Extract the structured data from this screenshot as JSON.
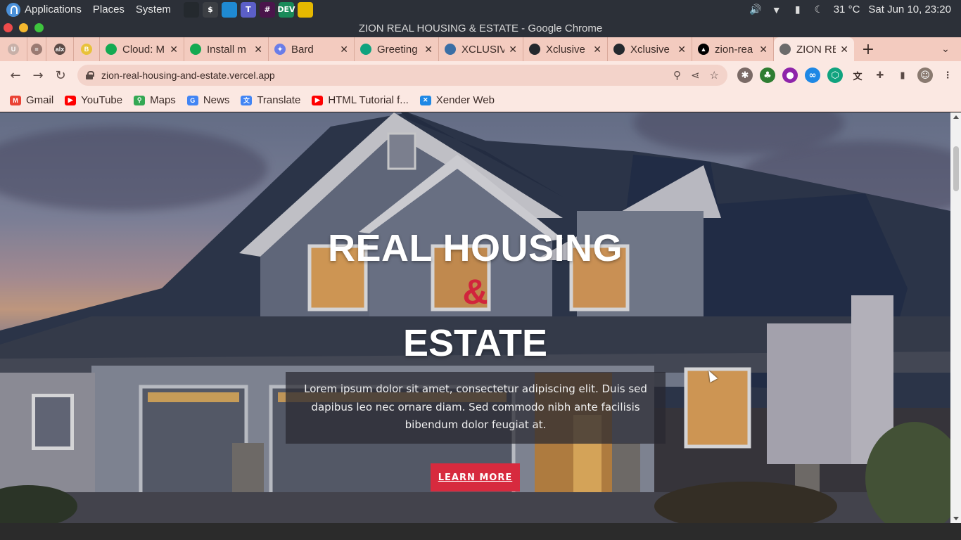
{
  "os_panel": {
    "menu": [
      "Applications",
      "Places",
      "System"
    ],
    "launchers": [
      {
        "name": "github-icon",
        "label": "",
        "color": "#24292e"
      },
      {
        "name": "terminal-icon",
        "label": "$",
        "color": "#3c3f44"
      },
      {
        "name": "vscode-icon",
        "label": "",
        "color": "#1f8ad2"
      },
      {
        "name": "teams-icon",
        "label": "T",
        "color": "#5b5fc7"
      },
      {
        "name": "slack-icon",
        "label": "#",
        "color": "#4a154b"
      },
      {
        "name": "edge-dev-icon",
        "label": "DEV",
        "color": "#1a8a5a"
      },
      {
        "name": "chrome-icon",
        "label": "",
        "color": "#e6b800"
      }
    ],
    "tray": {
      "temperature": "31 °C",
      "datetime": "Sat Jun 10, 23:20"
    }
  },
  "window": {
    "title": "ZION REAL HOUSING & ESTATE - Google Chrome"
  },
  "tabs": [
    {
      "title": "",
      "pinned": true,
      "fav_color": "#c8b0a8",
      "fav_label": "U",
      "icon": "ulauncher-tab-icon"
    },
    {
      "title": "",
      "pinned": true,
      "fav_color": "#9a7a72",
      "fav_label": "≡",
      "icon": "pinned-tab-icon"
    },
    {
      "title": "",
      "pinned": true,
      "fav_color": "#5b4a46",
      "fav_label": "alx",
      "icon": "alx-tab-icon"
    },
    {
      "title": "",
      "pinned": true,
      "fav_color": "#e8c23a",
      "fav_label": "B",
      "icon": "pinned-b-tab-icon"
    },
    {
      "title": "Cloud: M",
      "pinned": false,
      "fav_color": "#13aa52",
      "fav_label": "",
      "icon": "mongodb-tab-icon"
    },
    {
      "title": "Install m",
      "pinned": false,
      "fav_color": "#13aa52",
      "fav_label": "",
      "icon": "mongodb-tab-icon"
    },
    {
      "title": "Bard",
      "pinned": false,
      "fav_color": "#6a7de8",
      "fav_label": "✦",
      "icon": "bard-tab-icon"
    },
    {
      "title": "Greeting",
      "pinned": false,
      "fav_color": "#10a37f",
      "fav_label": "",
      "icon": "chatgpt-tab-icon"
    },
    {
      "title": "XCLUSIV",
      "pinned": false,
      "fav_color": "#3a6ea5",
      "fav_label": "",
      "icon": "xclusive-tab-icon"
    },
    {
      "title": "Xclusive",
      "pinned": false,
      "fav_color": "#24292e",
      "fav_label": "",
      "icon": "github-tab-icon"
    },
    {
      "title": "Xclusive",
      "pinned": false,
      "fav_color": "#24292e",
      "fav_label": "",
      "icon": "github-tab-icon"
    },
    {
      "title": "zion-rea",
      "pinned": false,
      "fav_color": "#000000",
      "fav_label": "▲",
      "icon": "vercel-tab-icon"
    },
    {
      "title": "ZION RE",
      "pinned": false,
      "active": true,
      "fav_color": "#6b6b6b",
      "fav_label": "",
      "icon": "globe-tab-icon"
    }
  ],
  "toolbar": {
    "url": "zion-real-housing-and-estate.vercel.app"
  },
  "extensions": [
    {
      "name": "bug-extension-icon",
      "color": "#7a6a66",
      "label": "✱"
    },
    {
      "name": "tree-extension-icon",
      "color": "#2e7d32",
      "label": "♣"
    },
    {
      "name": "purple-extension-icon",
      "color": "#8e24aa",
      "label": "●"
    },
    {
      "name": "infinity-extension-icon",
      "color": "#1e88e5",
      "label": "∞"
    },
    {
      "name": "hexagon-extension-icon",
      "color": "#10a37f",
      "label": "⬡"
    },
    {
      "name": "translate-extension-icon",
      "color": "#3a2a26",
      "label": "文"
    },
    {
      "name": "puzzle-extensions-icon",
      "color": "#5a4a46",
      "label": "✚"
    },
    {
      "name": "side-panel-icon",
      "color": "#5a4a46",
      "label": "▮"
    },
    {
      "name": "profile-avatar-icon",
      "color": "#8a7a70",
      "label": "☺"
    },
    {
      "name": "more-menu-icon",
      "color": "#5a4a46",
      "label": "⋮"
    }
  ],
  "bookmarks": [
    {
      "label": "Gmail",
      "icon": "gmail-icon",
      "color": "#ea4335",
      "glyph": "M"
    },
    {
      "label": "YouTube",
      "icon": "youtube-icon",
      "color": "#ff0000",
      "glyph": "▶"
    },
    {
      "label": "Maps",
      "icon": "maps-icon",
      "color": "#34a853",
      "glyph": "⚲"
    },
    {
      "label": "News",
      "icon": "news-icon",
      "color": "#4285f4",
      "glyph": "G"
    },
    {
      "label": "Translate",
      "icon": "translate-icon",
      "color": "#4285f4",
      "glyph": "文"
    },
    {
      "label": "HTML Tutorial f...",
      "icon": "youtube-icon",
      "color": "#ff0000",
      "glyph": "▶"
    },
    {
      "label": "Xender Web",
      "icon": "xender-icon",
      "color": "#1e88e5",
      "glyph": "✕"
    }
  ],
  "hero": {
    "title_line1": "REAL HOUSING",
    "ampersand": "&",
    "title_line2": "ESTATE",
    "description": "Lorem ipsum dolor sit amet, consectetur adipiscing elit. Duis sed dapibus leo nec ornare diam. Sed commodo nibh ante facilisis bibendum dolor feugiat at.",
    "cta_label": "LEARN MORE",
    "accent_color": "#d72a3e"
  }
}
